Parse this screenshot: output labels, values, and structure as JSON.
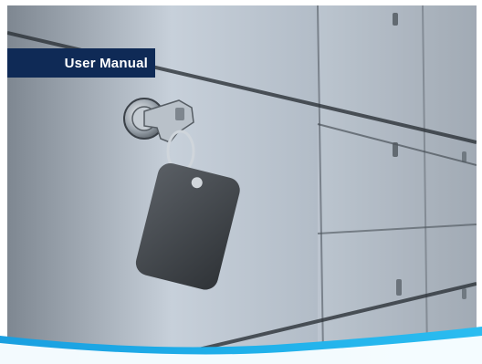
{
  "cover": {
    "title": "User Manual"
  },
  "colors": {
    "banner_bg": "#0f2a56",
    "banner_text": "#ffffff",
    "accent_blue": "#19a3e0",
    "accent_light": "#6cc8f0"
  },
  "image": {
    "subject": "lock-with-key-icon"
  }
}
